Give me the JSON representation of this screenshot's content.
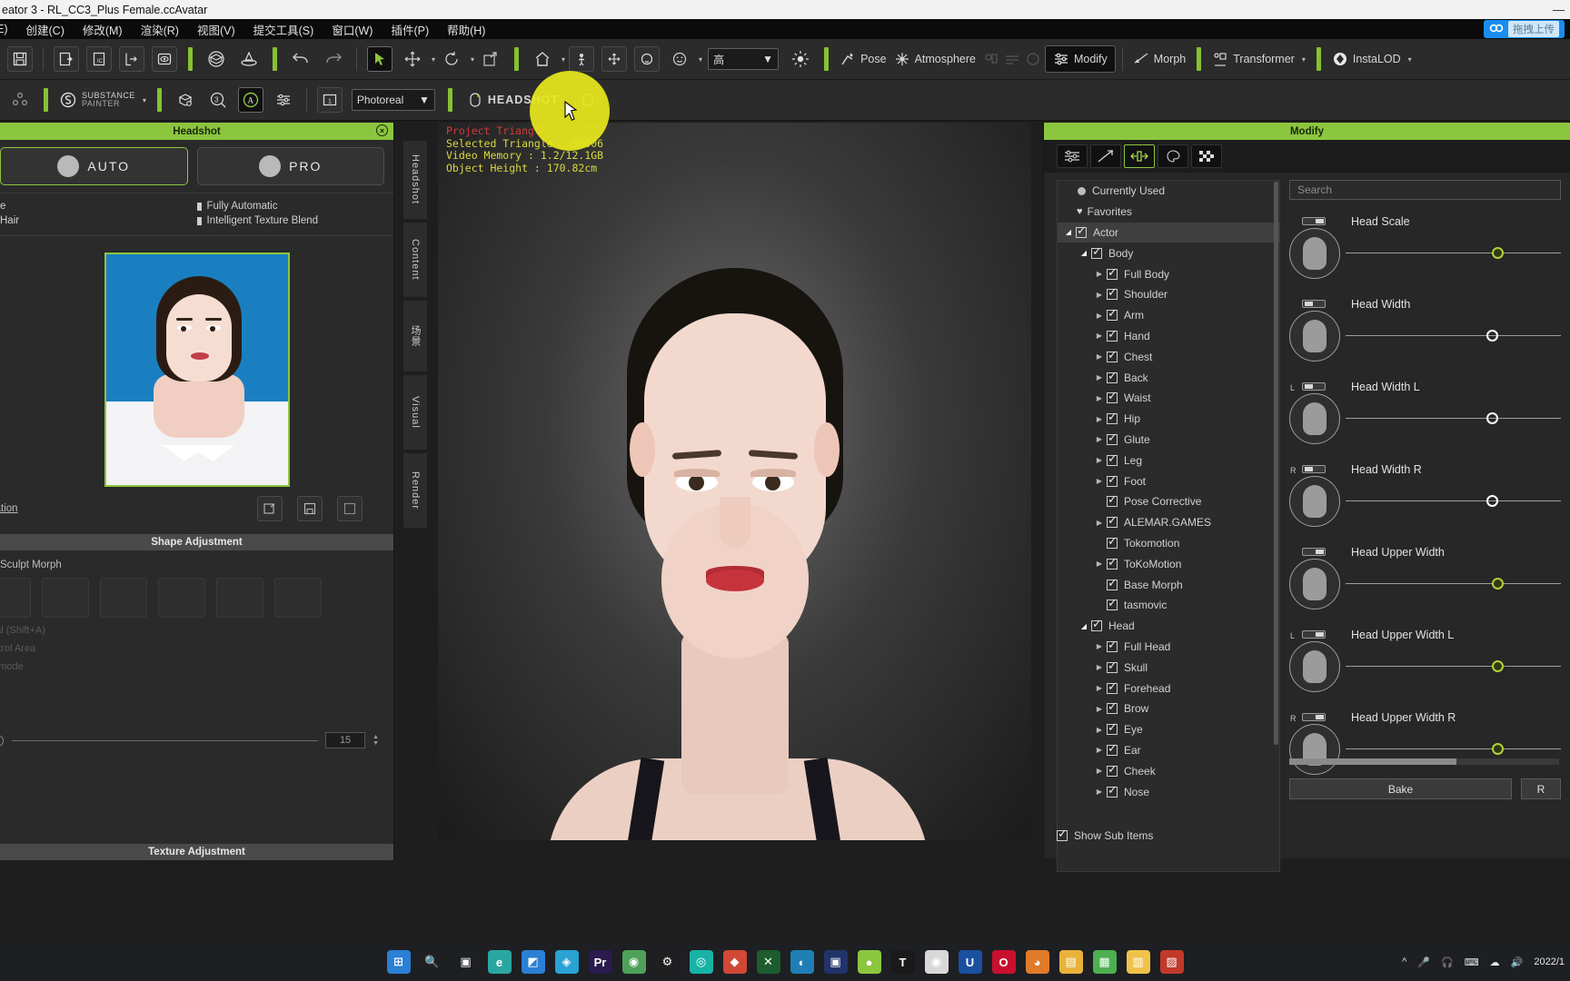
{
  "window": {
    "title": "eator 3 - RL_CC3_Plus Female.ccAvatar",
    "minimize": "—"
  },
  "menubar": {
    "items": [
      "E)",
      "创建(C)",
      "修改(M)",
      "渲染(R)",
      "视图(V)",
      "提交工具(S)",
      "窗口(W)",
      "插件(P)",
      "帮助(H)"
    ]
  },
  "cloud_badge": {
    "label": "拖拽上传"
  },
  "toolbar_top": {
    "quality_value": "高",
    "pose_label": "Pose",
    "atmosphere_label": "Atmosphere",
    "modify_label": "Modify",
    "morph_label": "Morph",
    "transformer_label": "Transformer",
    "instalod_label": "InstaLOD"
  },
  "toolbar_second": {
    "substance_label_1": "SUBSTANCE",
    "substance_label_2": "PAINTER",
    "render_mode": "Photoreal",
    "headshot_label": "HEADSHOT"
  },
  "headshot_panel": {
    "title": "Headshot",
    "close_icon": "×",
    "tabs": [
      {
        "label": "AUTO",
        "active": true
      },
      {
        "label": "PRO",
        "active": false
      }
    ],
    "options_left": [
      "e",
      "Hair"
    ],
    "options_right": [
      "Fully Automatic",
      "Intelligent Texture Blend"
    ],
    "preparation_link": "paration",
    "shape_adjustment_title": "Shape Adjustment",
    "sculpt_morph_label": "Sculpt Morph",
    "dim_texts": [
      "ntal (Shift+A)",
      "ontrol Area",
      "nt mode"
    ],
    "slider_value": "15",
    "texture_adjustment_title": "Texture Adjustment"
  },
  "vertical_tabs": [
    "Headshot",
    "Content",
    "场景",
    "Visual",
    "Render"
  ],
  "viewport": {
    "stats": [
      {
        "text": "Project Triangle",
        "color": "red"
      },
      {
        "text": "Selected Triangle : 50006",
        "color": "yellow"
      },
      {
        "text": "Video Memory : 1.2/12.1GB",
        "color": "yellow"
      },
      {
        "text": "Object Height : 170.82cm",
        "color": "yellow"
      }
    ]
  },
  "modify_panel": {
    "title": "Modify",
    "tab_icons": [
      "sliders-icon",
      "morph-icon",
      "scale-icon",
      "material-icon",
      "checker-icon"
    ],
    "tree": [
      {
        "label": "Currently Used",
        "indent": 0,
        "icon": "dot",
        "arrow": "",
        "checked": false
      },
      {
        "label": "Favorites",
        "indent": 0,
        "icon": "heart",
        "arrow": "",
        "checked": false
      },
      {
        "label": "Actor",
        "indent": 0,
        "icon": "check",
        "arrow": "open",
        "checked": true,
        "selected": true
      },
      {
        "label": "Body",
        "indent": 1,
        "icon": "check",
        "arrow": "open",
        "checked": true
      },
      {
        "label": "Full Body",
        "indent": 2,
        "icon": "check",
        "arrow": "closed",
        "checked": true
      },
      {
        "label": "Shoulder",
        "indent": 2,
        "icon": "check",
        "arrow": "closed",
        "checked": true
      },
      {
        "label": "Arm",
        "indent": 2,
        "icon": "check",
        "arrow": "closed",
        "checked": true
      },
      {
        "label": "Hand",
        "indent": 2,
        "icon": "check",
        "arrow": "closed",
        "checked": true
      },
      {
        "label": "Chest",
        "indent": 2,
        "icon": "check",
        "arrow": "closed",
        "checked": true
      },
      {
        "label": "Back",
        "indent": 2,
        "icon": "check",
        "arrow": "closed",
        "checked": true
      },
      {
        "label": "Waist",
        "indent": 2,
        "icon": "check",
        "arrow": "closed",
        "checked": true
      },
      {
        "label": "Hip",
        "indent": 2,
        "icon": "check",
        "arrow": "closed",
        "checked": true
      },
      {
        "label": "Glute",
        "indent": 2,
        "icon": "check",
        "arrow": "closed",
        "checked": true
      },
      {
        "label": "Leg",
        "indent": 2,
        "icon": "check",
        "arrow": "closed",
        "checked": true
      },
      {
        "label": "Foot",
        "indent": 2,
        "icon": "check",
        "arrow": "closed",
        "checked": true
      },
      {
        "label": "Pose Corrective",
        "indent": 2,
        "icon": "check",
        "arrow": "",
        "checked": true
      },
      {
        "label": "ALEMAR.GAMES",
        "indent": 2,
        "icon": "check",
        "arrow": "closed",
        "checked": true
      },
      {
        "label": "Tokomotion",
        "indent": 2,
        "icon": "check",
        "arrow": "",
        "checked": true
      },
      {
        "label": "ToKoMotion",
        "indent": 2,
        "icon": "check",
        "arrow": "closed",
        "checked": true
      },
      {
        "label": "Base Morph",
        "indent": 2,
        "icon": "check",
        "arrow": "",
        "checked": true
      },
      {
        "label": "tasmovic",
        "indent": 2,
        "icon": "check",
        "arrow": "",
        "checked": true
      },
      {
        "label": "Head",
        "indent": 1,
        "icon": "check",
        "arrow": "open",
        "checked": true
      },
      {
        "label": "Full Head",
        "indent": 2,
        "icon": "check",
        "arrow": "closed",
        "checked": true
      },
      {
        "label": "Skull",
        "indent": 2,
        "icon": "check",
        "arrow": "closed",
        "checked": true
      },
      {
        "label": "Forehead",
        "indent": 2,
        "icon": "check",
        "arrow": "closed",
        "checked": true
      },
      {
        "label": "Brow",
        "indent": 2,
        "icon": "check",
        "arrow": "closed",
        "checked": true
      },
      {
        "label": "Eye",
        "indent": 2,
        "icon": "check",
        "arrow": "closed",
        "checked": true
      },
      {
        "label": "Ear",
        "indent": 2,
        "icon": "check",
        "arrow": "closed",
        "checked": true
      },
      {
        "label": "Cheek",
        "indent": 2,
        "icon": "check",
        "arrow": "closed",
        "checked": true
      },
      {
        "label": "Nose",
        "indent": 2,
        "icon": "check",
        "arrow": "closed",
        "checked": true
      }
    ],
    "show_sub_items": "Show Sub Items",
    "search_placeholder": "Search",
    "sliders": [
      {
        "name": "Head Scale",
        "side": "",
        "pos": 56,
        "green": true
      },
      {
        "name": "Head Width",
        "side": "",
        "pos": 54,
        "green": false
      },
      {
        "name": "Head Width L",
        "side": "L",
        "pos": 54,
        "green": false
      },
      {
        "name": "Head Width R",
        "side": "R",
        "pos": 54,
        "green": false
      },
      {
        "name": "Head Upper Width",
        "side": "",
        "pos": 56,
        "green": true
      },
      {
        "name": "Head Upper Width L",
        "side": "L",
        "pos": 56,
        "green": true
      },
      {
        "name": "Head Upper Width R",
        "side": "R",
        "pos": 56,
        "green": true
      }
    ],
    "buttons": [
      {
        "label": "Bake"
      },
      {
        "label": "R"
      }
    ]
  },
  "taskbar": {
    "clock": "2022/1",
    "items": [
      {
        "name": "start-button",
        "glyph": "⊞",
        "color": "#2b7fd4"
      },
      {
        "name": "search-icon",
        "glyph": "🔍",
        "color": "transparent"
      },
      {
        "name": "task-view-icon",
        "glyph": "▣",
        "color": "transparent"
      },
      {
        "name": "edge-icon",
        "glyph": "e",
        "color": "#2aa6a0"
      },
      {
        "name": "app-blue-icon",
        "glyph": "◩",
        "color": "#2b7fd4"
      },
      {
        "name": "app-teal-icon",
        "glyph": "◈",
        "color": "#2aa2d4"
      },
      {
        "name": "premiere-icon",
        "glyph": "Pr",
        "color": "#2a1b4d"
      },
      {
        "name": "chrome-icon",
        "glyph": "◉",
        "color": "#4fa05a"
      },
      {
        "name": "settings-icon",
        "glyph": "⚙",
        "color": "#1f1f1f"
      },
      {
        "name": "record-icon",
        "glyph": "◎",
        "color": "#19b3a6"
      },
      {
        "name": "app-red-icon",
        "glyph": "◆",
        "color": "#d14836"
      },
      {
        "name": "x-app-icon",
        "glyph": "✕",
        "color": "#1d5c2e"
      },
      {
        "name": "app-cyan-icon",
        "glyph": "◐",
        "color": "#1f7fb5"
      },
      {
        "name": "app-navy-icon",
        "glyph": "▣",
        "color": "#22336b"
      },
      {
        "name": "cc-app-icon",
        "glyph": "●",
        "color": "#8cc63f"
      },
      {
        "name": "tenc-icon",
        "glyph": "T",
        "color": "#1a1a1a"
      },
      {
        "name": "chrome2-icon",
        "glyph": "◉",
        "color": "#d8d8d8"
      },
      {
        "name": "uc-icon",
        "glyph": "U",
        "color": "#1b4fa0"
      },
      {
        "name": "opera-icon",
        "glyph": "O",
        "color": "#c8102e"
      },
      {
        "name": "browser-icon",
        "glyph": "◕",
        "color": "#e07b2a"
      },
      {
        "name": "folder-icon",
        "glyph": "▤",
        "color": "#e8b23a"
      },
      {
        "name": "green-app-icon",
        "glyph": "▦",
        "color": "#4caf50"
      },
      {
        "name": "explorer-icon",
        "glyph": "▥",
        "color": "#f0c24a"
      },
      {
        "name": "red-app-icon",
        "glyph": "▨",
        "color": "#c0392b"
      }
    ],
    "tray": [
      "^",
      "🎤",
      "🎧",
      "⌨",
      "☁",
      "🔊"
    ]
  }
}
